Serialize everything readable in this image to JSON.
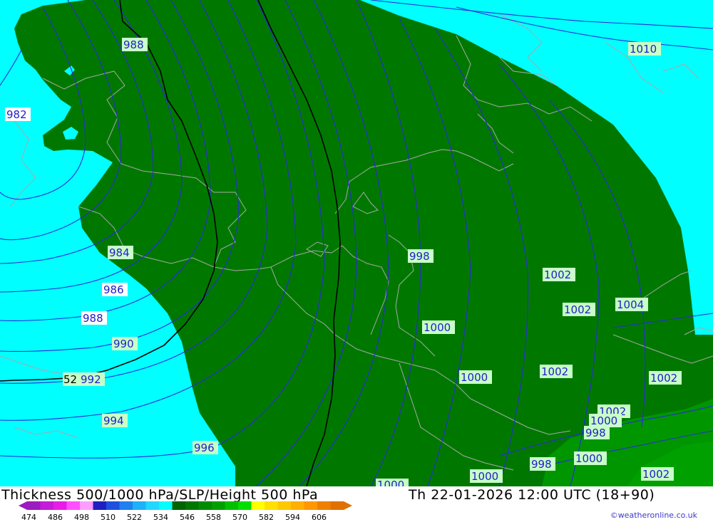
{
  "header": {
    "title": "Thickness 500/1000 hPa/SLP/Height 500 hPa",
    "valid_time": "Th 22-01-2026 12:00 UTC (18+90)"
  },
  "credit": "©weatheronline.co.uk",
  "colors": {
    "sea_cyan": "#00ffff",
    "thickness_dark_green": "#007800",
    "thickness_mid_green": "#009600",
    "isobar_blue": "#2b2bd8",
    "height_black": "#000000",
    "border_grey": "#a0a0a0",
    "label_bg": "#c8ffc8"
  },
  "isobar_labels": [
    {
      "text": "988"
    },
    {
      "text": "1010"
    },
    {
      "text": "982"
    },
    {
      "text": "984"
    },
    {
      "text": "986"
    },
    {
      "text": "988"
    },
    {
      "text": "990"
    },
    {
      "text": "992"
    },
    {
      "text": "52"
    },
    {
      "text": "994"
    },
    {
      "text": "996"
    },
    {
      "text": "998"
    },
    {
      "text": "1002"
    },
    {
      "text": "1002"
    },
    {
      "text": "1004"
    },
    {
      "text": "1000"
    },
    {
      "text": "1000"
    },
    {
      "text": "1002"
    },
    {
      "text": "1002"
    },
    {
      "text": "1002"
    },
    {
      "text": "1000"
    },
    {
      "text": "998"
    },
    {
      "text": "998"
    },
    {
      "text": "1000"
    },
    {
      "text": "1000"
    },
    {
      "text": "1002"
    },
    {
      "text": "1000"
    }
  ],
  "scale": {
    "ticks": [
      "474",
      "486",
      "498",
      "510",
      "522",
      "534",
      "546",
      "558",
      "570",
      "582",
      "594",
      "606"
    ],
    "colors": [
      "#9c1cc0",
      "#c41cd8",
      "#e81ce8",
      "#ff50ff",
      "#ff9cff",
      "#2020c0",
      "#2050e0",
      "#2080f0",
      "#20b0f8",
      "#20d8ff",
      "#00ffff",
      "#006400",
      "#007800",
      "#008c00",
      "#00a000",
      "#00c000",
      "#00e000",
      "#ffff00",
      "#ffe000",
      "#ffc800",
      "#ffb000",
      "#ff9800",
      "#f08000",
      "#e07000"
    ]
  }
}
